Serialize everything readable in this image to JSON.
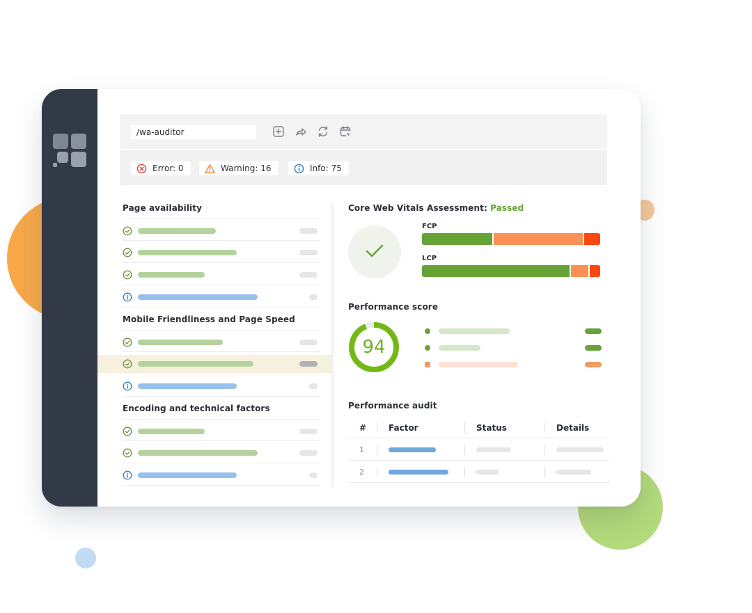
{
  "toolbar": {
    "url_value": "/wa-auditor",
    "icons": [
      "add-icon",
      "share-icon",
      "refresh-icon",
      "schedule-icon"
    ]
  },
  "status": {
    "error_label": "Error: 0",
    "warning_label": "Warning: 16",
    "info_label": "Info: 75",
    "colors": {
      "error": "#d9473f",
      "warning": "#e9883a",
      "info": "#2f7fc1"
    }
  },
  "left_panel": {
    "sections": [
      {
        "title": "Page availability",
        "items": [
          {
            "status": "pass",
            "icon": "check-circle-icon"
          },
          {
            "status": "pass",
            "icon": "check-circle-icon"
          },
          {
            "status": "pass",
            "icon": "check-circle-icon"
          },
          {
            "status": "info",
            "icon": "info-circle-icon"
          }
        ]
      },
      {
        "title": "Mobile Friendliness and Page Speed",
        "items": [
          {
            "status": "pass",
            "icon": "check-circle-icon"
          },
          {
            "status": "pass",
            "icon": "check-circle-icon",
            "highlighted": true
          },
          {
            "status": "info",
            "icon": "info-circle-icon"
          }
        ]
      },
      {
        "title": "Encoding and technical factors",
        "items": [
          {
            "status": "pass",
            "icon": "check-circle-icon"
          },
          {
            "status": "pass",
            "icon": "check-circle-icon"
          },
          {
            "status": "info",
            "icon": "info-circle-icon"
          }
        ]
      }
    ]
  },
  "core_web_vitals": {
    "title": "Core Web Vitals Assessment:",
    "result": "Passed",
    "result_color": "#6aa13a",
    "metrics": [
      {
        "label": "FCP",
        "good": 0.4,
        "needs_improvement": 0.51,
        "poor": 0.09
      },
      {
        "label": "LCP",
        "good": 0.84,
        "needs_improvement": 0.1,
        "poor": 0.06
      }
    ],
    "colors": {
      "good": "#66a337",
      "needs_improvement": "#fb9156",
      "poor": "#fb4811"
    }
  },
  "performance_score": {
    "title": "Performance score",
    "score": "94",
    "score_fraction": 0.94,
    "color": "#74b816",
    "legend": [
      {
        "marker": "dot",
        "color": "#6aa13a"
      },
      {
        "marker": "dot",
        "color": "#6aa13a"
      },
      {
        "marker": "square",
        "color": "#f39a61"
      }
    ]
  },
  "performance_audit": {
    "title": "Performance audit",
    "columns": [
      "#",
      "Factor",
      "Status",
      "Details"
    ],
    "rows": [
      {
        "num": "1"
      },
      {
        "num": "2"
      }
    ]
  }
}
